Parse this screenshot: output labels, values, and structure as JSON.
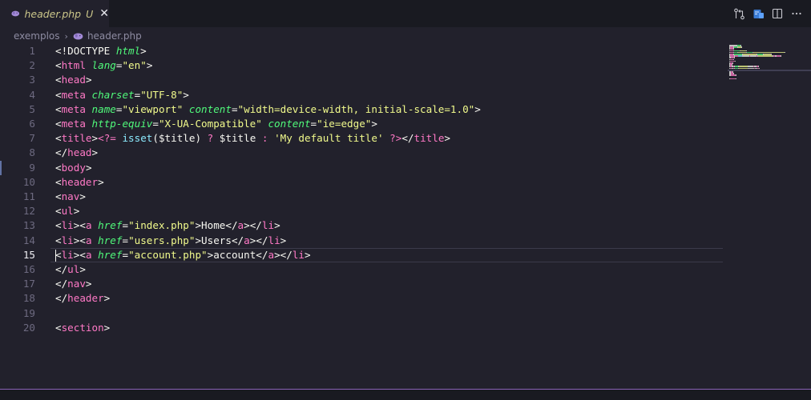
{
  "tab": {
    "file_name": "header.php",
    "status": "U",
    "close_glyph": "✕",
    "icon": "php-elephant-icon"
  },
  "actions": [
    {
      "name": "compare-changes-icon"
    },
    {
      "name": "open-preview-icon"
    },
    {
      "name": "split-editor-icon"
    },
    {
      "name": "more-actions-icon"
    }
  ],
  "breadcrumb": {
    "folder": "exemplos",
    "separator": "›",
    "file": "header.php"
  },
  "editor": {
    "active_line": 15,
    "lines": [
      {
        "n": "1",
        "tokens": [
          [
            "t-plain",
            "<!DOCTYPE "
          ],
          [
            "t-attr",
            "html"
          ],
          [
            "t-plain",
            ">"
          ]
        ]
      },
      {
        "n": "2",
        "tokens": [
          [
            "t-plain",
            "<"
          ],
          [
            "t-tag",
            "html"
          ],
          [
            "t-plain",
            " "
          ],
          [
            "t-attr",
            "lang"
          ],
          [
            "t-plain",
            "="
          ],
          [
            "t-str",
            "\"en\""
          ],
          [
            "t-plain",
            ">"
          ]
        ]
      },
      {
        "n": "3",
        "tokens": [
          [
            "t-plain",
            "<"
          ],
          [
            "t-tag",
            "head"
          ],
          [
            "t-plain",
            ">"
          ]
        ]
      },
      {
        "n": "4",
        "tokens": [
          [
            "t-plain",
            "<"
          ],
          [
            "t-tag",
            "meta"
          ],
          [
            "t-plain",
            " "
          ],
          [
            "t-attr",
            "charset"
          ],
          [
            "t-plain",
            "="
          ],
          [
            "t-str",
            "\"UTF-8\""
          ],
          [
            "t-plain",
            ">"
          ]
        ]
      },
      {
        "n": "5",
        "tokens": [
          [
            "t-plain",
            "<"
          ],
          [
            "t-tag",
            "meta"
          ],
          [
            "t-plain",
            " "
          ],
          [
            "t-attr",
            "name"
          ],
          [
            "t-plain",
            "="
          ],
          [
            "t-str",
            "\"viewport\""
          ],
          [
            "t-plain",
            " "
          ],
          [
            "t-attr",
            "content"
          ],
          [
            "t-plain",
            "="
          ],
          [
            "t-str",
            "\"width=device-width, initial-scale=1.0\""
          ],
          [
            "t-plain",
            ">"
          ]
        ]
      },
      {
        "n": "6",
        "tokens": [
          [
            "t-plain",
            "<"
          ],
          [
            "t-tag",
            "meta"
          ],
          [
            "t-plain",
            " "
          ],
          [
            "t-attr",
            "http-equiv"
          ],
          [
            "t-plain",
            "="
          ],
          [
            "t-str",
            "\"X-UA-Compatible\""
          ],
          [
            "t-plain",
            " "
          ],
          [
            "t-attr",
            "content"
          ],
          [
            "t-plain",
            "="
          ],
          [
            "t-str",
            "\"ie=edge\""
          ],
          [
            "t-plain",
            ">"
          ]
        ]
      },
      {
        "n": "7",
        "tokens": [
          [
            "t-plain",
            "<"
          ],
          [
            "t-tag",
            "title"
          ],
          [
            "t-plain",
            ">"
          ],
          [
            "t-php",
            "<?= "
          ],
          [
            "t-fn",
            "isset"
          ],
          [
            "t-plain",
            "($title) "
          ],
          [
            "t-kw",
            "?"
          ],
          [
            "t-plain",
            " $title "
          ],
          [
            "t-kw",
            ":"
          ],
          [
            "t-plain",
            " "
          ],
          [
            "t-str",
            "'My default title'"
          ],
          [
            "t-plain",
            " "
          ],
          [
            "t-php",
            "?>"
          ],
          [
            "t-plain",
            "</"
          ],
          [
            "t-tag",
            "title"
          ],
          [
            "t-plain",
            ">"
          ]
        ]
      },
      {
        "n": "8",
        "tokens": [
          [
            "t-plain",
            "</"
          ],
          [
            "t-tag",
            "head"
          ],
          [
            "t-plain",
            ">"
          ]
        ]
      },
      {
        "n": "9",
        "tokens": [
          [
            "t-plain",
            "<"
          ],
          [
            "t-tag",
            "body"
          ],
          [
            "t-plain",
            ">"
          ]
        ]
      },
      {
        "n": "10",
        "tokens": [
          [
            "t-plain",
            "<"
          ],
          [
            "t-tag",
            "header"
          ],
          [
            "t-plain",
            ">"
          ]
        ]
      },
      {
        "n": "11",
        "tokens": [
          [
            "t-plain",
            "<"
          ],
          [
            "t-tag",
            "nav"
          ],
          [
            "t-plain",
            ">"
          ]
        ]
      },
      {
        "n": "12",
        "tokens": [
          [
            "t-plain",
            "<"
          ],
          [
            "t-tag",
            "ul"
          ],
          [
            "t-plain",
            ">"
          ]
        ]
      },
      {
        "n": "13",
        "tokens": [
          [
            "t-plain",
            "<"
          ],
          [
            "t-tag",
            "li"
          ],
          [
            "t-plain",
            "><"
          ],
          [
            "t-tag",
            "a"
          ],
          [
            "t-plain",
            " "
          ],
          [
            "t-attr",
            "href"
          ],
          [
            "t-plain",
            "="
          ],
          [
            "t-str",
            "\"index.php\""
          ],
          [
            "t-plain",
            ">Home</"
          ],
          [
            "t-tag",
            "a"
          ],
          [
            "t-plain",
            "></"
          ],
          [
            "t-tag",
            "li"
          ],
          [
            "t-plain",
            ">"
          ]
        ]
      },
      {
        "n": "14",
        "tokens": [
          [
            "t-plain",
            "<"
          ],
          [
            "t-tag",
            "li"
          ],
          [
            "t-plain",
            "><"
          ],
          [
            "t-tag",
            "a"
          ],
          [
            "t-plain",
            " "
          ],
          [
            "t-attr",
            "href"
          ],
          [
            "t-plain",
            "="
          ],
          [
            "t-str",
            "\"users.php\""
          ],
          [
            "t-plain",
            ">Users</"
          ],
          [
            "t-tag",
            "a"
          ],
          [
            "t-plain",
            "></"
          ],
          [
            "t-tag",
            "li"
          ],
          [
            "t-plain",
            ">"
          ]
        ]
      },
      {
        "n": "15",
        "tokens": [
          [
            "t-plain",
            "<"
          ],
          [
            "t-tag",
            "li"
          ],
          [
            "t-plain",
            "><"
          ],
          [
            "t-tag",
            "a"
          ],
          [
            "t-plain",
            " "
          ],
          [
            "t-attr",
            "href"
          ],
          [
            "t-plain",
            "="
          ],
          [
            "t-str",
            "\"account.php\""
          ],
          [
            "t-plain",
            ">account</"
          ],
          [
            "t-tag",
            "a"
          ],
          [
            "t-plain",
            "></"
          ],
          [
            "t-tag",
            "li"
          ],
          [
            "t-plain",
            ">"
          ]
        ]
      },
      {
        "n": "16",
        "tokens": [
          [
            "t-plain",
            "</"
          ],
          [
            "t-tag",
            "ul"
          ],
          [
            "t-plain",
            ">"
          ]
        ]
      },
      {
        "n": "17",
        "tokens": [
          [
            "t-plain",
            "</"
          ],
          [
            "t-tag",
            "nav"
          ],
          [
            "t-plain",
            ">"
          ]
        ]
      },
      {
        "n": "18",
        "tokens": [
          [
            "t-plain",
            "</"
          ],
          [
            "t-tag",
            "header"
          ],
          [
            "t-plain",
            ">"
          ]
        ]
      },
      {
        "n": "19",
        "tokens": []
      },
      {
        "n": "20",
        "tokens": [
          [
            "t-plain",
            "<"
          ],
          [
            "t-tag",
            "section"
          ],
          [
            "t-plain",
            ">"
          ]
        ]
      }
    ]
  },
  "colors": {
    "background": "#22212c",
    "tabbar": "#191a21",
    "tag": "#ff79c6",
    "attribute": "#50fa7b",
    "string": "#f1fa8c",
    "function": "#8be9fd",
    "text": "#f8f8f2",
    "line_number": "#6d6a80",
    "panel_border": "#8b62b8"
  }
}
